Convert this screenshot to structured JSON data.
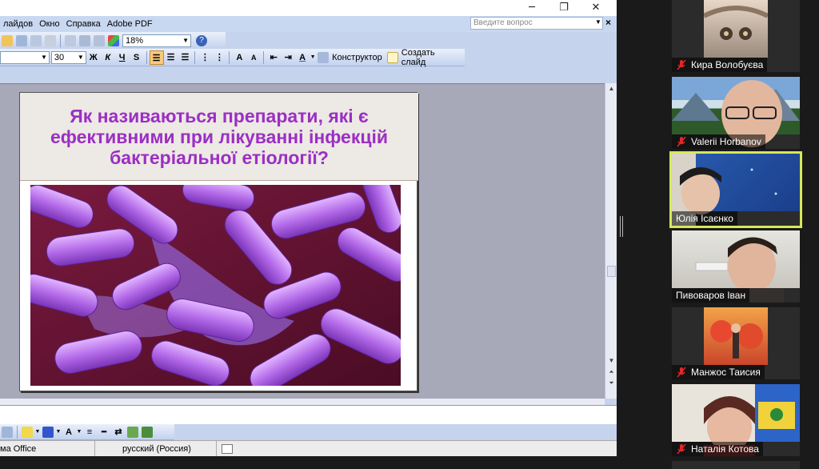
{
  "window": {
    "minimize_glyph": "─",
    "maximize_glyph": "❐",
    "close_glyph": "✕"
  },
  "menu": {
    "items": [
      "лайдов",
      "Окно",
      "Справка",
      "Adobe PDF"
    ]
  },
  "help_search": {
    "placeholder": "Введите вопрос",
    "close_glyph": "×"
  },
  "toolbar1": {
    "zoom_value": "18%"
  },
  "toolbar2": {
    "font_size": "30",
    "bold": "Ж",
    "italic": "К",
    "underline": "Ч",
    "shadow": "S",
    "grow_font": "A",
    "shrink_font": "A",
    "designer_label": "Конструктор",
    "new_slide_label": "Создать слайд"
  },
  "slide": {
    "title_line1": "Як називаються препарати, які є",
    "title_line2": "ефективними при лікуванні інфекцій",
    "title_line3": "бактеріальної етіології?"
  },
  "status": {
    "theme": "ма Office",
    "language": "русский (Россия)"
  },
  "participants": [
    {
      "name": "Кира Волобуєва",
      "muted": true,
      "active": false
    },
    {
      "name": "Valerii Horbanov",
      "muted": true,
      "active": false
    },
    {
      "name": "Юлія Ісаєнко",
      "muted": false,
      "active": true
    },
    {
      "name": "Пивоваров Іван",
      "muted": false,
      "active": false
    },
    {
      "name": "Манжос Таисия",
      "muted": true,
      "active": false
    },
    {
      "name": "Наталія Котова",
      "muted": true,
      "active": false
    }
  ],
  "colors": {
    "title_purple": "#9b2fc4",
    "active_border": "#d6e85a",
    "mute_red": "#e02828",
    "office_blue": "#c6d3ec"
  }
}
